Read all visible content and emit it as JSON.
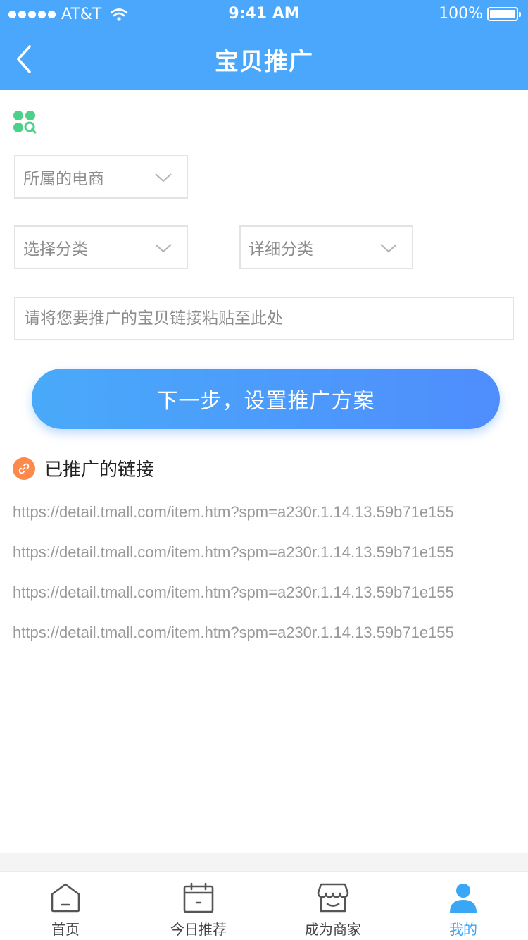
{
  "status_bar": {
    "carrier": "AT&T",
    "time": "9:41 AM",
    "battery": "100%"
  },
  "nav": {
    "title": "宝贝推广",
    "back_icon": "chevron-left-icon"
  },
  "colors": {
    "primary": "#4aa7fb",
    "button_gradient_start": "#49aaf9",
    "button_gradient_end": "#4f8dfd",
    "link_badge": "#fb8a4c",
    "brand_icon": "#4cd18b",
    "tab_active": "#3aa6f6"
  },
  "form": {
    "ecommerce_select": "所属的电商",
    "category_select": "选择分类",
    "subcategory_select": "详细分类",
    "link_placeholder": "请将您要推广的宝贝链接粘贴至此处",
    "next_button": "下一步，设置推广方案"
  },
  "promoted": {
    "title": "已推广的链接",
    "links": [
      "https://detail.tmall.com/item.htm?spm=a230r.1.14.13.59b71e155",
      "https://detail.tmall.com/item.htm?spm=a230r.1.14.13.59b71e155",
      "https://detail.tmall.com/item.htm?spm=a230r.1.14.13.59b71e155",
      "https://detail.tmall.com/item.htm?spm=a230r.1.14.13.59b71e155"
    ]
  },
  "tabbar": {
    "items": [
      {
        "label": "首页",
        "icon": "home-icon"
      },
      {
        "label": "今日推荐",
        "icon": "calendar-icon"
      },
      {
        "label": "成为商家",
        "icon": "store-icon"
      },
      {
        "label": "我的",
        "icon": "user-icon"
      }
    ],
    "active_index": 3
  }
}
